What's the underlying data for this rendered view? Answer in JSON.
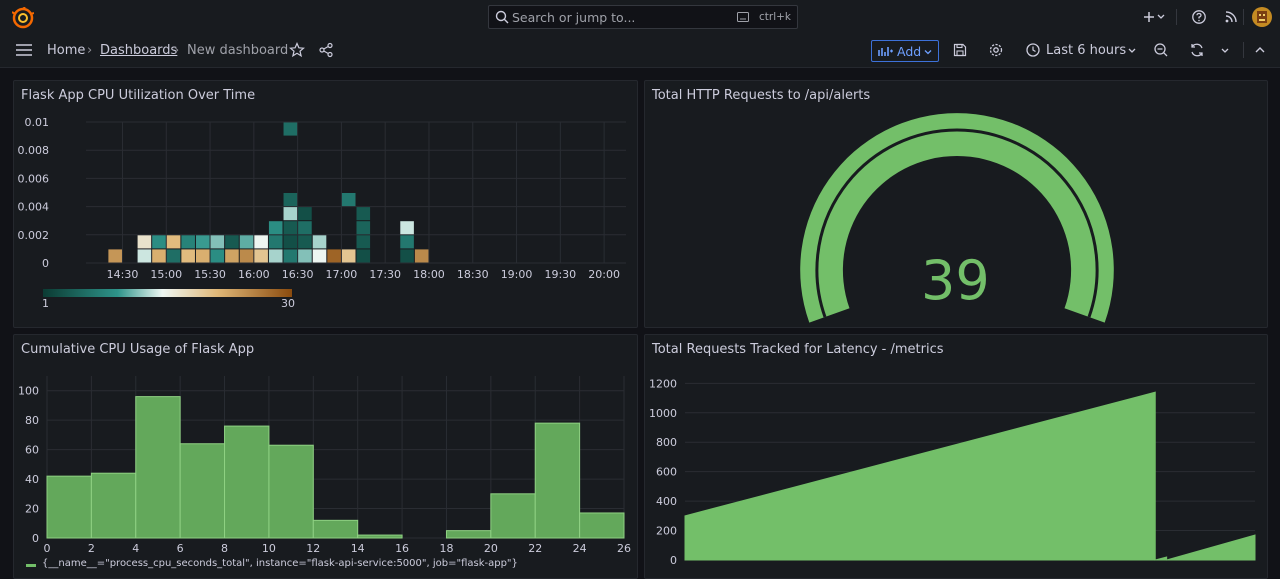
{
  "topbar": {
    "search_placeholder": "Search or jump to...",
    "shortcut": "ctrl+k",
    "icons": [
      "grafana-logo-icon",
      "search-icon",
      "plus-icon",
      "chevron-down-icon",
      "help-icon",
      "news-icon",
      "avatar"
    ]
  },
  "subbar": {
    "breadcrumb_home": "Home",
    "breadcrumb_sep": "›",
    "breadcrumb_dashboards": "Dashboards",
    "breadcrumb_current": "New dashboard",
    "add_label": "Add",
    "time_range": "Last 6 hours",
    "icons": [
      "menu-icon",
      "star-icon",
      "share-icon",
      "save-icon",
      "settings-icon",
      "clock-icon",
      "zoom-out-icon",
      "refresh-icon"
    ]
  },
  "panels": {
    "heatmap_title": "Flask App CPU Utilization Over Time",
    "gauge_title": "Total HTTP Requests to /api/alerts",
    "histogram_title": "Cumulative CPU Usage of Flask App",
    "latency_title": "Total Requests Tracked for Latency - /metrics"
  },
  "colors": {
    "background": "#111217",
    "panel": "#181b1f",
    "green": "#73bf69",
    "accent_blue": "#6e9fff"
  },
  "chart_data": [
    {
      "type": "heatmap",
      "x_ticks": [
        "14:30",
        "15:00",
        "15:30",
        "16:00",
        "16:30",
        "17:00",
        "17:30",
        "18:00",
        "18:30",
        "19:00",
        "19:30",
        "20:00"
      ],
      "y_ticks": [
        "0",
        "0.002",
        "0.004",
        "0.006",
        "0.008",
        "0.01"
      ],
      "ylim": [
        0,
        0.01
      ],
      "color_scale_min": "1",
      "color_scale_max": "30",
      "cells": [
        {
          "t": "14:20",
          "y": 0,
          "v": 24
        },
        {
          "t": "14:40",
          "y": 0,
          "v": 14
        },
        {
          "t": "14:40",
          "y": 0.001,
          "v": 17
        },
        {
          "t": "14:50",
          "y": 0,
          "v": 22
        },
        {
          "t": "14:50",
          "y": 0.001,
          "v": 9
        },
        {
          "t": "15:00",
          "y": 0,
          "v": 6
        },
        {
          "t": "15:00",
          "y": 0.001,
          "v": 21
        },
        {
          "t": "15:10",
          "y": 0,
          "v": 21
        },
        {
          "t": "15:10",
          "y": 0.001,
          "v": 8
        },
        {
          "t": "15:20",
          "y": 0,
          "v": 22
        },
        {
          "t": "15:20",
          "y": 0.001,
          "v": 10
        },
        {
          "t": "15:30",
          "y": 0,
          "v": 9
        },
        {
          "t": "15:30",
          "y": 0.001,
          "v": 12
        },
        {
          "t": "15:40",
          "y": 0,
          "v": 23
        },
        {
          "t": "15:40",
          "y": 0.001,
          "v": 4
        },
        {
          "t": "15:50",
          "y": 0,
          "v": 25
        },
        {
          "t": "15:50",
          "y": 0.001,
          "v": 11
        },
        {
          "t": "16:00",
          "y": 0,
          "v": 20
        },
        {
          "t": "16:00",
          "y": 0.001,
          "v": 15
        },
        {
          "t": "16:10",
          "y": 0,
          "v": 13
        },
        {
          "t": "16:10",
          "y": 0.001,
          "v": 7
        },
        {
          "t": "16:10",
          "y": 0.002,
          "v": 9
        },
        {
          "t": "16:20",
          "y": 0,
          "v": 7
        },
        {
          "t": "16:20",
          "y": 0.001,
          "v": 3
        },
        {
          "t": "16:20",
          "y": 0.002,
          "v": 4
        },
        {
          "t": "16:20",
          "y": 0.003,
          "v": 13
        },
        {
          "t": "16:20",
          "y": 0.004,
          "v": 5
        },
        {
          "t": "16:20",
          "y": 0.009,
          "v": 6
        },
        {
          "t": "16:30",
          "y": 0,
          "v": 12
        },
        {
          "t": "16:30",
          "y": 0.001,
          "v": 4
        },
        {
          "t": "16:30",
          "y": 0.002,
          "v": 6
        },
        {
          "t": "16:30",
          "y": 0.003,
          "v": 3
        },
        {
          "t": "16:40",
          "y": 0,
          "v": 15
        },
        {
          "t": "16:40",
          "y": 0.001,
          "v": 13
        },
        {
          "t": "16:50",
          "y": 0,
          "v": 28
        },
        {
          "t": "17:00",
          "y": 0,
          "v": 20
        },
        {
          "t": "17:00",
          "y": 0.004,
          "v": 7
        },
        {
          "t": "17:10",
          "y": 0,
          "v": 3
        },
        {
          "t": "17:10",
          "y": 0.001,
          "v": 4
        },
        {
          "t": "17:10",
          "y": 0.002,
          "v": 5
        },
        {
          "t": "17:10",
          "y": 0.003,
          "v": 4
        },
        {
          "t": "17:40",
          "y": 0,
          "v": 3
        },
        {
          "t": "17:40",
          "y": 0.001,
          "v": 7
        },
        {
          "t": "17:40",
          "y": 0.002,
          "v": 14
        },
        {
          "t": "17:50",
          "y": 0,
          "v": 25
        }
      ]
    },
    {
      "type": "gauge",
      "value": 39,
      "min": 0,
      "max": 39
    },
    {
      "type": "bar",
      "x_ticks": [
        "0",
        "2",
        "4",
        "6",
        "8",
        "10",
        "12",
        "14",
        "16",
        "18",
        "20",
        "22",
        "24",
        "26"
      ],
      "y_ticks": [
        "0",
        "20",
        "40",
        "60",
        "80",
        "100"
      ],
      "ylim": [
        0,
        110
      ],
      "xlim": [
        0,
        26
      ],
      "bin_width": 2,
      "bins": [
        {
          "start": 0,
          "value": 42
        },
        {
          "start": 2,
          "value": 44
        },
        {
          "start": 4,
          "value": 96
        },
        {
          "start": 6,
          "value": 64
        },
        {
          "start": 8,
          "value": 76
        },
        {
          "start": 10,
          "value": 63
        },
        {
          "start": 12,
          "value": 12
        },
        {
          "start": 14,
          "value": 2
        },
        {
          "start": 16,
          "value": 0
        },
        {
          "start": 18,
          "value": 5
        },
        {
          "start": 20,
          "value": 30
        },
        {
          "start": 22,
          "value": 78
        },
        {
          "start": 24,
          "value": 17
        }
      ],
      "legend": "{__name__=\"process_cpu_seconds_total\", instance=\"flask-api-service:5000\", job=\"flask-app\"}"
    },
    {
      "type": "area",
      "y_ticks": [
        "0",
        "200",
        "400",
        "600",
        "800",
        "1000",
        "1200"
      ],
      "ylim": [
        0,
        1250
      ],
      "xlim": [
        0,
        100
      ],
      "series": [
        {
          "x": [
            0,
            82.5,
            82.5,
            84.5,
            84.5,
            100
          ],
          "y": [
            300,
            1140,
            0,
            20,
            0,
            170
          ]
        }
      ]
    }
  ]
}
